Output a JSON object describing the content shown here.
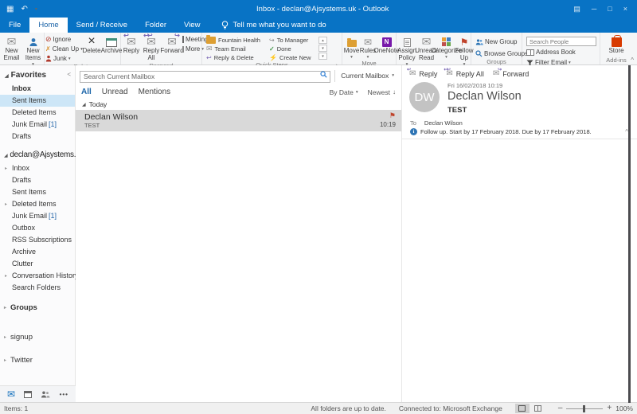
{
  "titlebar": {
    "title": "Inbox - declan@Ajsystems.uk - Outlook"
  },
  "tabs": {
    "file": "File",
    "home": "Home",
    "send_receive": "Send / Receive",
    "folder": "Folder",
    "view": "View",
    "tellme": "Tell me what you want to do"
  },
  "ribbon": {
    "new_email": "New Email",
    "new_items": "New Items",
    "group_new": "New",
    "ignore": "Ignore",
    "clean_up": "Clean Up",
    "junk": "Junk",
    "delete": "Delete",
    "archive": "Archive",
    "group_delete": "Delete",
    "reply": "Reply",
    "reply_all": "Reply All",
    "forward": "Forward",
    "meeting": "Meeting",
    "more": "More",
    "group_respond": "Respond",
    "quick_steps": [
      "Fountain Health",
      "Team Email",
      "Reply & Delete",
      "To Manager",
      "Done",
      "Create New"
    ],
    "group_quick_steps": "Quick Steps",
    "move": "Move",
    "rules": "Rules",
    "onenote": "OneNote",
    "group_move": "Move",
    "assign_policy": "Assign Policy",
    "unread_read": "Unread/ Read",
    "categorize": "Categorize",
    "follow_up": "Follow Up",
    "group_tags": "Tags",
    "new_group": "New Group",
    "browse_groups": "Browse Groups",
    "group_groups": "Groups",
    "search_people": "Search People",
    "address_book": "Address Book",
    "filter_email": "Filter Email",
    "group_find": "Find",
    "store": "Store",
    "group_addins": "Add-ins"
  },
  "sidebar": {
    "favorites_header": "Favorites",
    "favorites": [
      {
        "label": "Inbox"
      },
      {
        "label": "Sent Items"
      },
      {
        "label": "Deleted Items"
      },
      {
        "label": "Junk Email",
        "count": "[1]"
      },
      {
        "label": "Drafts"
      }
    ],
    "account_header": "declan@Ajsystems.uk",
    "account_folders": [
      {
        "label": "Inbox"
      },
      {
        "label": "Drafts"
      },
      {
        "label": "Sent Items"
      },
      {
        "label": "Deleted Items"
      },
      {
        "label": "Junk Email",
        "count": "[1]"
      },
      {
        "label": "Outbox"
      },
      {
        "label": "RSS Subscriptions"
      },
      {
        "label": "Archive"
      },
      {
        "label": "Clutter"
      },
      {
        "label": "Conversation History"
      },
      {
        "label": "Search Folders"
      }
    ],
    "groups_header": "Groups",
    "signup": "signup",
    "twitter": "Twitter"
  },
  "list": {
    "search_placeholder": "Search Current Mailbox",
    "scope": "Current Mailbox",
    "filters": [
      "All",
      "Unread",
      "Mentions"
    ],
    "sort_by": "By Date",
    "sort_dir": "Newest",
    "group": "Today",
    "messages": [
      {
        "sender": "Declan Wilson",
        "subject": "TEST",
        "time": "10:19",
        "flagged": true,
        "selected": true
      }
    ]
  },
  "reading": {
    "reply": "Reply",
    "reply_all": "Reply All",
    "forward": "Forward",
    "date": "Fri 16/02/2018 10:19",
    "avatar_initials": "DW",
    "sender": "Declan Wilson",
    "subject": "TEST",
    "to_label": "To",
    "to": "Declan Wilson",
    "followup": "Follow up. Start by 17 February 2018. Due by 17 February 2018."
  },
  "statusbar": {
    "items": "Items: 1",
    "sync": "All folders are up to date.",
    "connection": "Connected to: Microsoft Exchange",
    "zoom": "100%"
  },
  "colors": {
    "titlebar_blue": "#0873c5",
    "accent_blue": "#1b64a8",
    "flag_red": "#c0442c",
    "selected_message_gray": "#d9d9d9",
    "sidebar_selected_blue": "#cde6f7",
    "onenote_purple": "#7719aa",
    "store_orange": "#d83b01"
  }
}
